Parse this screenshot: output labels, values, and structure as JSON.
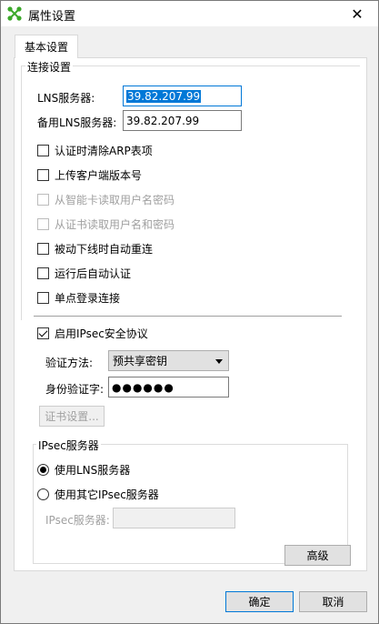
{
  "window": {
    "title": "属性设置",
    "close_glyph": "✕"
  },
  "tabs": [
    {
      "label": "基本设置"
    }
  ],
  "connection": {
    "legend": "连接设置",
    "lns_label": "LNS服务器:",
    "lns_value": "39.82.207.99",
    "backup_lns_label": "备用LNS服务器:",
    "backup_lns_value": "39.82.207.99",
    "options": [
      {
        "label": "认证时清除ARP表项",
        "checked": false,
        "enabled": true
      },
      {
        "label": "上传客户端版本号",
        "checked": false,
        "enabled": true
      },
      {
        "label": "从智能卡读取用户名密码",
        "checked": false,
        "enabled": false
      },
      {
        "label": "从证书读取用户名和密码",
        "checked": false,
        "enabled": false
      },
      {
        "label": "被动下线时自动重连",
        "checked": false,
        "enabled": true
      },
      {
        "label": "运行后自动认证",
        "checked": false,
        "enabled": true
      },
      {
        "label": "单点登录连接",
        "checked": false,
        "enabled": true
      }
    ]
  },
  "ipsec": {
    "enable_label": "启用IPsec安全协议",
    "enable_checked": true,
    "auth_method_label": "验证方法:",
    "auth_method_value": "预共享密钥",
    "identity_label": "身份验证字:",
    "identity_value": "●●●●●●",
    "cert_button": "证书设置...",
    "server_group": {
      "legend": "IPsec服务器",
      "use_lns_label": "使用LNS服务器",
      "use_lns_selected": true,
      "use_other_label": "使用其它IPsec服务器",
      "use_other_selected": false,
      "server_label": "IPsec服务器:",
      "server_value": ""
    }
  },
  "advanced_button": "高级",
  "ok_button": "确定",
  "cancel_button": "取消",
  "colors": {
    "accent": "#0078d7",
    "icon_green": "#3aa829"
  }
}
